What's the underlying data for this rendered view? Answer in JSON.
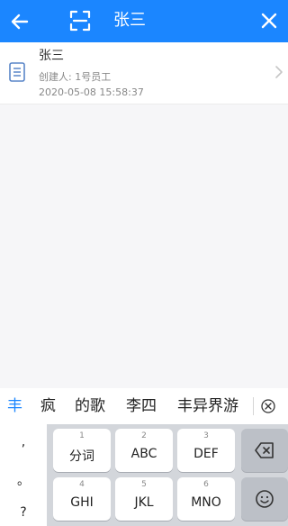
{
  "header": {
    "title": "张三",
    "back_icon": "back-arrow-icon",
    "scan_icon": "scan-icon",
    "close_icon": "close-icon",
    "background_color": "#1b86ff"
  },
  "result": {
    "name": "张三",
    "creator": "创建人: 1号员工",
    "date": "2020-05-08 15:58:37",
    "icon": "document-icon",
    "chevron": "chevron-right-icon"
  },
  "candidates": {
    "items": [
      "丰",
      "疯",
      "的歌",
      "李四",
      "丰异界游"
    ],
    "collapse_icon": "close-circle-icon"
  },
  "keyboard": {
    "punctuation": [
      ",",
      "。",
      "?"
    ],
    "keys": [
      {
        "num": "1",
        "label": "分词"
      },
      {
        "num": "2",
        "label": "ABC"
      },
      {
        "num": "3",
        "label": "DEF"
      },
      {
        "num": "4",
        "label": "GHI"
      },
      {
        "num": "5",
        "label": "JKL"
      },
      {
        "num": "6",
        "label": "MNO"
      }
    ],
    "backspace_icon": "backspace-icon",
    "emoji_icon": "emoji-icon"
  }
}
